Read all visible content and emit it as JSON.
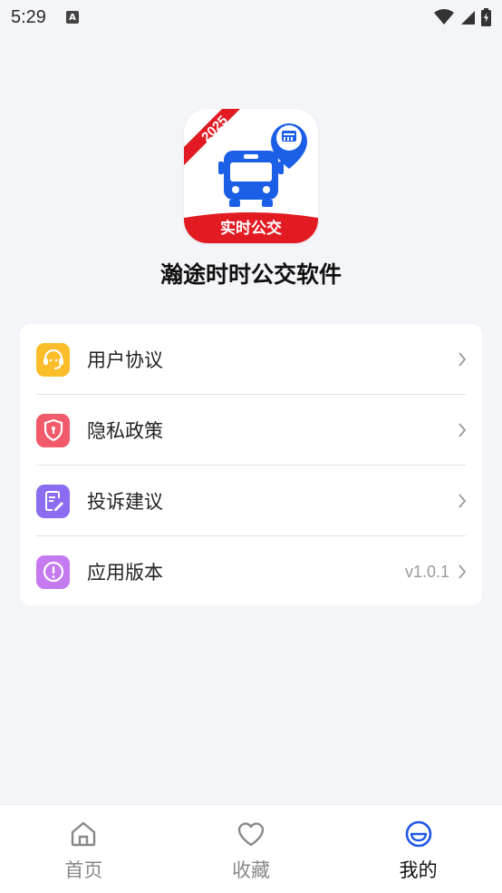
{
  "status_bar": {
    "time": "5:29",
    "notification_icon": "a-letter-icon"
  },
  "app": {
    "name": "瀚途时时公交软件",
    "logo": {
      "year_ribbon": "2025",
      "banner_text": "实时公交",
      "bus_color": "#1b5fe6",
      "banner_color": "#e21b23"
    }
  },
  "menu": {
    "items": [
      {
        "label": "用户协议",
        "icon": "headset-icon",
        "value": ""
      },
      {
        "label": "隐私政策",
        "icon": "shield-icon",
        "value": ""
      },
      {
        "label": "投诉建议",
        "icon": "edit-document-icon",
        "value": ""
      },
      {
        "label": "应用版本",
        "icon": "info-exclamation-icon",
        "value": "v1.0.1"
      }
    ]
  },
  "tabs": [
    {
      "label": "首页",
      "icon": "home-icon",
      "active": false
    },
    {
      "label": "收藏",
      "icon": "heart-icon",
      "active": false
    },
    {
      "label": "我的",
      "icon": "profile-icon",
      "active": true
    }
  ],
  "colors": {
    "active_tab": "#1f57e8",
    "inactive_tab": "#888888"
  }
}
